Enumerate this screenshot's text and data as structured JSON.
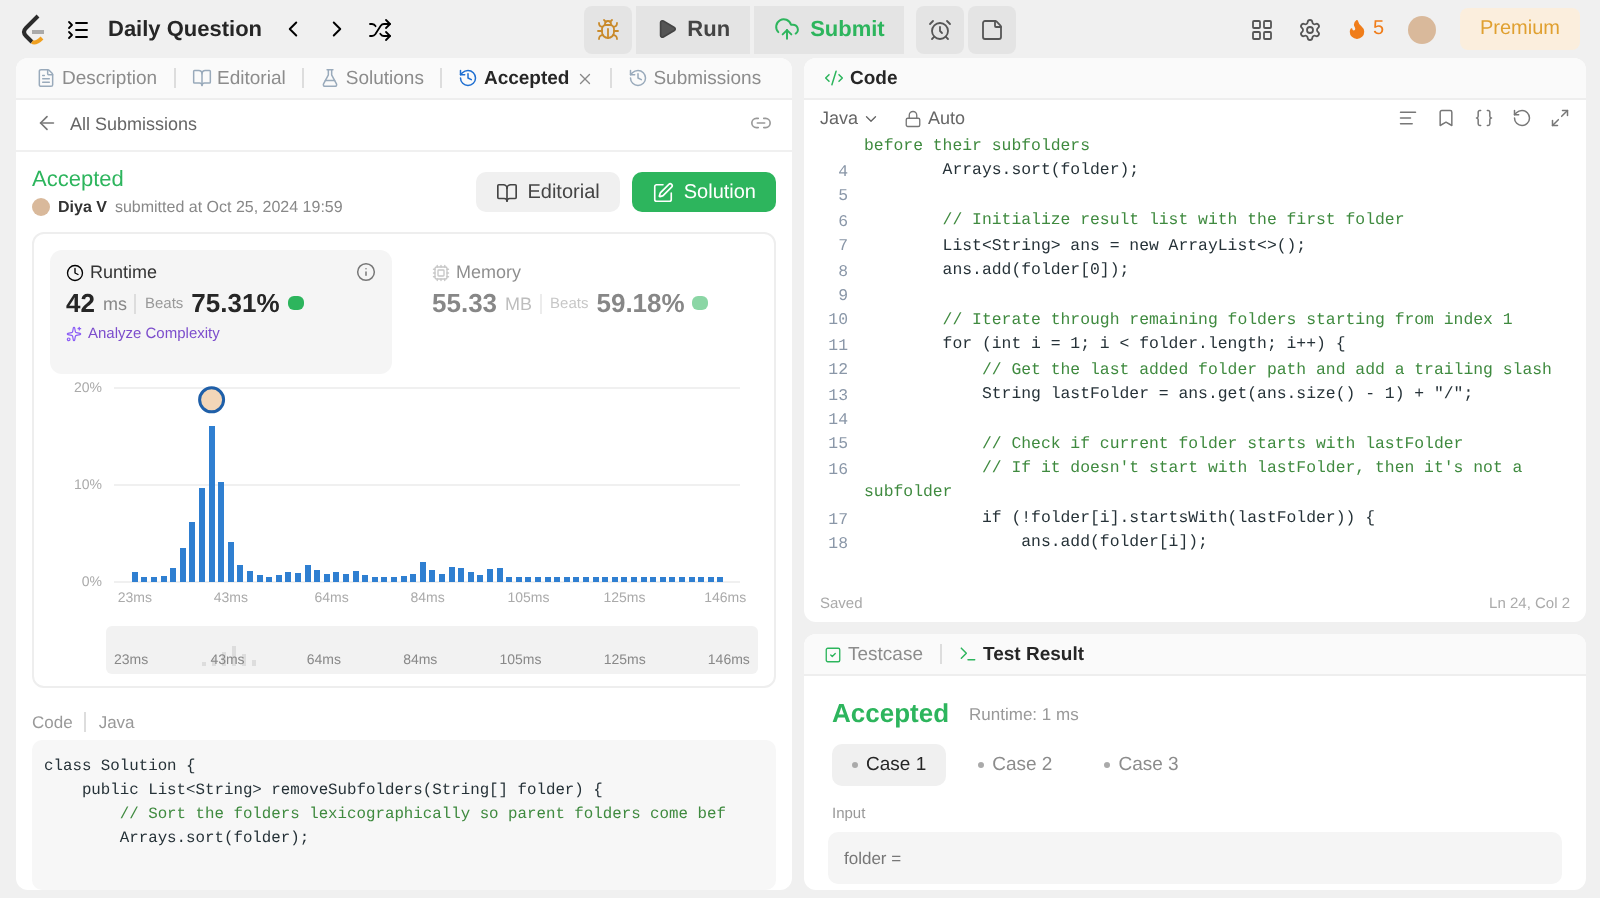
{
  "top_bar": {
    "title": "Daily Question",
    "run": "Run",
    "submit": "Submit",
    "streak": "5",
    "premium": "Premium"
  },
  "left_tabs": [
    {
      "label": "Description",
      "selected": false,
      "closable": false
    },
    {
      "label": "Editorial",
      "selected": false,
      "closable": false
    },
    {
      "label": "Solutions",
      "selected": false,
      "closable": false
    },
    {
      "label": "Accepted",
      "selected": true,
      "closable": true
    },
    {
      "label": "Submissions",
      "selected": false,
      "closable": false
    }
  ],
  "back_link": "All Submissions",
  "submission": {
    "status": "Accepted",
    "user": "Diya V",
    "submitted": "submitted at Oct 25, 2024 19:59",
    "editorial_button": "Editorial",
    "solution_button": "Solution"
  },
  "metrics": [
    {
      "label": "Runtime",
      "value": "42",
      "unit": "ms",
      "beats_label": "Beats",
      "beats": "75.31%",
      "selected": true,
      "action": "Analyze Complexity"
    },
    {
      "label": "Memory",
      "value": "55.33",
      "unit": "MB",
      "beats_label": "Beats",
      "beats": "59.18%",
      "selected": false
    }
  ],
  "chart_data": {
    "type": "bar",
    "x": [
      23,
      25,
      27,
      29,
      31,
      33,
      35,
      37,
      39,
      41,
      43,
      45,
      47,
      49,
      51,
      53,
      55,
      57,
      59,
      61,
      63,
      65,
      67,
      69,
      71,
      73,
      75,
      77,
      79,
      81,
      83,
      85,
      87,
      89,
      91,
      93,
      95,
      97,
      99,
      101,
      103,
      105,
      107,
      109,
      111,
      113,
      115,
      117,
      119,
      121,
      123,
      125,
      127,
      129,
      131,
      133,
      135,
      137,
      139,
      141,
      143,
      145
    ],
    "values": [
      1.0,
      0.5,
      0.5,
      0.6,
      1.4,
      3.5,
      6.2,
      9.7,
      16.1,
      10.3,
      4.1,
      1.8,
      1.1,
      0.7,
      0.5,
      0.7,
      1.0,
      0.9,
      1.8,
      1.2,
      0.8,
      1.0,
      0.8,
      1.1,
      0.7,
      0.5,
      0.5,
      0.5,
      0.6,
      0.8,
      2.1,
      1.2,
      0.8,
      1.5,
      1.4,
      1.0,
      0.7,
      1.3,
      1.4,
      0.5,
      0.5,
      0.5,
      0.5,
      0.5,
      0.5,
      0.5,
      0.5,
      0.5,
      0.5,
      0.5,
      0.5,
      0.5,
      0.5,
      0.5,
      0.5,
      0.5,
      0.5,
      0.5,
      0.5,
      0.5,
      0.5,
      0.5
    ],
    "xlim": [
      22,
      147
    ],
    "ylim": [
      0,
      20
    ],
    "yticks": [
      {
        "value": 0,
        "label": "0%"
      },
      {
        "value": 10,
        "label": "10%"
      },
      {
        "value": 20,
        "label": "20%"
      }
    ],
    "xticks": [
      {
        "value": 23,
        "label": "23ms"
      },
      {
        "value": 43,
        "label": "43ms"
      },
      {
        "value": 64,
        "label": "64ms"
      },
      {
        "value": 84,
        "label": "84ms"
      },
      {
        "value": 105,
        "label": "105ms"
      },
      {
        "value": 125,
        "label": "125ms"
      },
      {
        "value": 146,
        "label": "146ms"
      }
    ]
  },
  "navigator_labels": [
    "23ms",
    "43ms",
    "64ms",
    "84ms",
    "105ms",
    "125ms",
    "146ms"
  ],
  "code_meta": {
    "label": "Code",
    "language": "Java"
  },
  "submitted_code": [
    {
      "text": "class Solution {",
      "kind": "code"
    },
    {
      "text": "    public List<String> removeSubfolders(String[] folder) {",
      "kind": "code"
    },
    {
      "text": "        // Sort the folders lexicographically so parent folders come bef",
      "kind": "comment"
    },
    {
      "text": "        Arrays.sort(folder);",
      "kind": "code"
    }
  ],
  "editor": {
    "title": "Code",
    "language": "Java",
    "mode": "Auto",
    "saved": "Saved",
    "cursor": "Ln 24, Col 2",
    "lines": [
      {
        "text": "before their subfolders",
        "kind": "comment"
      },
      {
        "num": "4",
        "text": "        Arrays.sort(folder);",
        "kind": "code"
      },
      {
        "num": "5"
      },
      {
        "num": "6",
        "text": "        // Initialize result list with the first folder",
        "kind": "comment"
      },
      {
        "num": "7",
        "text": "        List<String> ans = new ArrayList<>();",
        "kind": "code"
      },
      {
        "num": "8",
        "text": "        ans.add(folder[0]);",
        "kind": "code"
      },
      {
        "num": "9"
      },
      {
        "num": "10",
        "text": "        // Iterate through remaining folders starting from index 1",
        "kind": "comment"
      },
      {
        "num": "11",
        "text": "        for (int i = 1; i < folder.length; i++) {",
        "kind": "code"
      },
      {
        "num": "12",
        "text": "            // Get the last added folder path and add a trailing slash",
        "kind": "comment"
      },
      {
        "num": "13",
        "text": "            String lastFolder = ans.get(ans.size() - 1) + \"/\";",
        "kind": "code"
      },
      {
        "num": "14"
      },
      {
        "num": "15",
        "text": "            // Check if current folder starts with lastFolder",
        "kind": "comment"
      },
      {
        "num": "16",
        "text": "            // If it doesn't start with lastFolder, then it's not a",
        "kind": "comment"
      },
      {
        "text": "subfolder",
        "kind": "comment"
      },
      {
        "num": "17",
        "text": "            if (!folder[i].startsWith(lastFolder)) {",
        "kind": "code"
      },
      {
        "num": "18",
        "text": "                ans.add(folder[i]);",
        "kind": "code"
      }
    ]
  },
  "result_tabs": [
    {
      "label": "Testcase",
      "selected": false
    },
    {
      "label": "Test Result",
      "selected": true
    }
  ],
  "result": {
    "status": "Accepted",
    "runtime": "Runtime: 1 ms",
    "input_label": "Input",
    "input_value": "folder ="
  },
  "cases": [
    {
      "label": "Case 1",
      "selected": true
    },
    {
      "label": "Case 2",
      "selected": false
    },
    {
      "label": "Case 3",
      "selected": false
    }
  ]
}
